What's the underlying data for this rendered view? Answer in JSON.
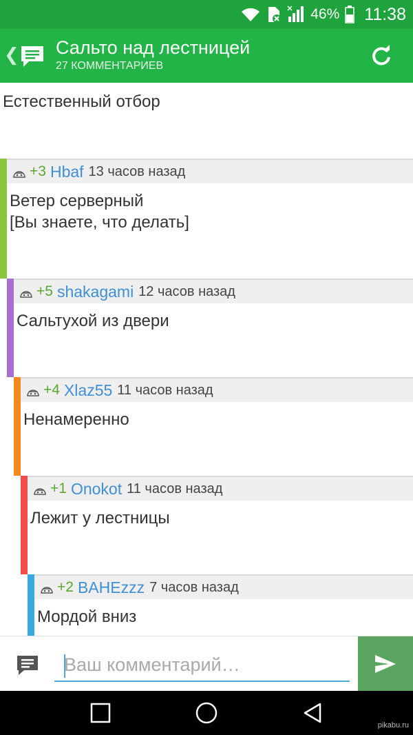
{
  "status_bar": {
    "battery_percent": "46%",
    "time": "11:38",
    "icons": [
      "wifi-icon",
      "sim-no-service-icon",
      "signal-icon",
      "battery-icon"
    ]
  },
  "header": {
    "title": "Сальто над лестницей",
    "subtitle": "27 КОММЕНТАРИЕВ",
    "back_icon": "chevron-left-icon",
    "logo_icon": "chat-bubble-icon",
    "refresh_icon": "refresh-icon"
  },
  "post": {
    "text": "Естественный отбор"
  },
  "comments": [
    {
      "rating": "+3",
      "user": "Hbaf",
      "time": "13 часов назад",
      "text": "Ветер серверный\n[Вы знаете, что делать]",
      "depth": 0,
      "color": "#8cc63f"
    },
    {
      "rating": "+5",
      "user": "shakagami",
      "time": "12 часов назад",
      "text": "Сальтухой из двери",
      "depth": 1,
      "color": "#a96fd0"
    },
    {
      "rating": "+4",
      "user": "Xlaz55",
      "time": "11 часов назад",
      "text": "Ненамеренно",
      "depth": 2,
      "color": "#f5891e"
    },
    {
      "rating": "+1",
      "user": "Onokot",
      "time": "11 часов назад",
      "text": "Лежит у лестницы",
      "depth": 3,
      "color": "#f24b4b"
    },
    {
      "rating": "+2",
      "user": "BAHEzzz",
      "time": "7 часов назад",
      "text": "Мордой вниз",
      "depth": 4,
      "color": "#3aa9e0"
    }
  ],
  "composer": {
    "placeholder": "Ваш комментарий…",
    "value": "",
    "send_icon": "send-icon"
  },
  "nav_bar": {
    "buttons": [
      "recents-square-icon",
      "home-circle-icon",
      "back-triangle-icon"
    ]
  },
  "watermark": "pikabu.ru",
  "colors": {
    "status_bar": "#1fa33c",
    "header": "#23b447",
    "rating": "#5aa832",
    "username": "#3d8fd6",
    "send_button": "#5aa45f",
    "input_underline": "#48a8d8"
  }
}
